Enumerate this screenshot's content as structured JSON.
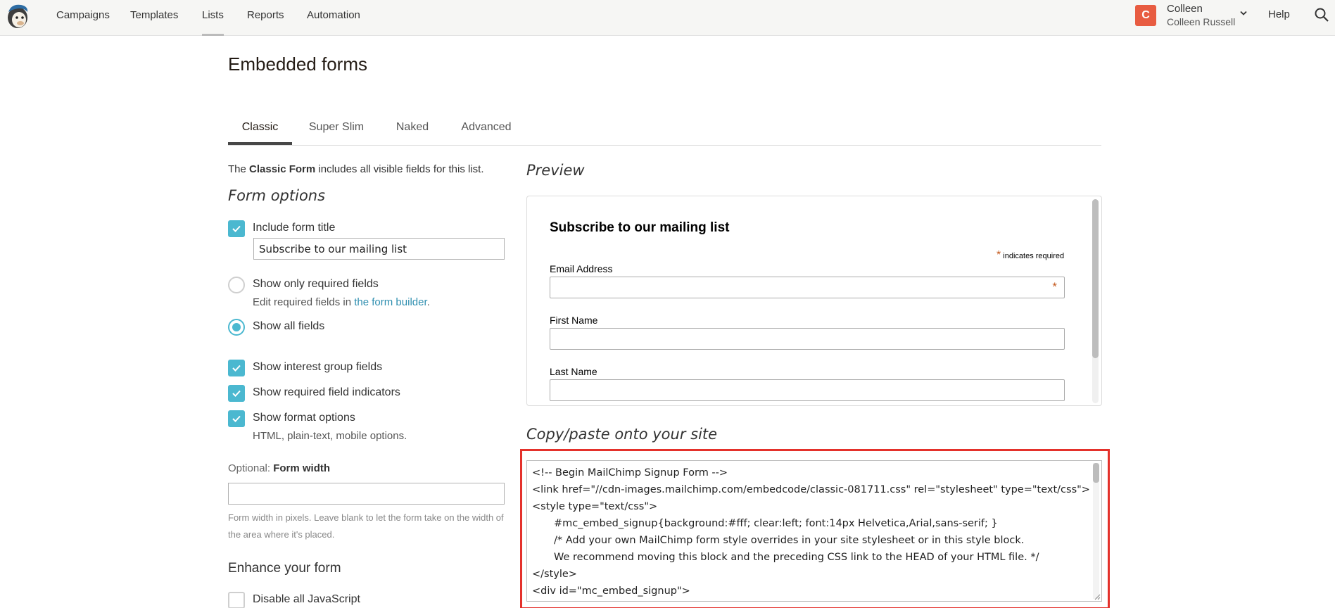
{
  "nav": {
    "items": [
      "Campaigns",
      "Templates",
      "Lists",
      "Reports",
      "Automation"
    ],
    "active": "Lists",
    "user_initial": "C",
    "user_first": "Colleen",
    "user_full": "Colleen Russell",
    "help": "Help",
    "icons": [
      "mailchimp-logo",
      "chevron-down-icon",
      "search-icon"
    ]
  },
  "page": {
    "title": "Embedded forms"
  },
  "tabs": [
    "Classic",
    "Super Slim",
    "Naked",
    "Advanced"
  ],
  "left": {
    "intro_pre": "The ",
    "intro_bold": "Classic Form",
    "intro_post": " includes all visible fields for this list.",
    "form_options_heading": "Form options",
    "include_title_label": "Include form title",
    "include_title_value": "Subscribe to our mailing list",
    "required_only_label": "Show only required fields",
    "required_only_sub_pre": "Edit required fields in ",
    "required_only_sub_link": "the form builder",
    "required_only_sub_post": ".",
    "all_fields_label": "Show all fields",
    "interest_label": "Show interest group fields",
    "indicators_label": "Show required field indicators",
    "format_label": "Show format options",
    "format_sub": "HTML, plain-text, mobile options.",
    "optional_prefix": "Optional: ",
    "width_label": "Form width",
    "width_value": "",
    "width_hint": "Form width in pixels. Leave blank to let the form take on the width of the area where it's placed.",
    "enhance_heading": "Enhance your form",
    "disable_js_label": "Disable all JavaScript"
  },
  "preview": {
    "heading": "Preview",
    "form_title": "Subscribe to our mailing list",
    "required_star": "*",
    "required_note": " indicates required",
    "fields": [
      "Email Address",
      "First Name",
      "Last Name"
    ]
  },
  "code": {
    "heading": "Copy/paste onto your site",
    "lines": [
      "<!-- Begin MailChimp Signup Form -->",
      "<link href=\"//cdn-images.mailchimp.com/embedcode/classic-081711.css\" rel=\"stylesheet\" type=\"text/css\">",
      "<style type=\"text/css\">",
      "\t#mc_embed_signup{background:#fff; clear:left; font:14px Helvetica,Arial,sans-serif; }",
      "\t/* Add your own MailChimp form style overrides in your site stylesheet or in this style block.",
      "\t   We recommend moving this block and the preceding CSS link to the HEAD of your HTML file. */",
      "</style>",
      "<div id=\"mc_embed_signup\">"
    ]
  },
  "colors": {
    "accent": "#4bb8d0",
    "highlight_border": "#e4312b",
    "avatar": "#e85c41",
    "link": "#2f8fb0"
  }
}
